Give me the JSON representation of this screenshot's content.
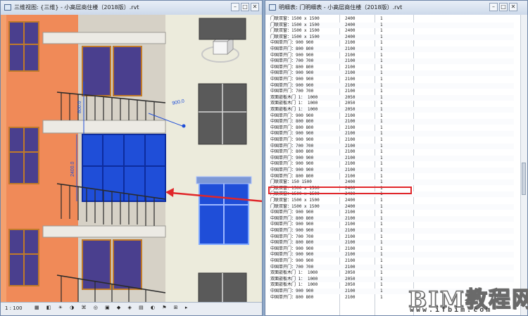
{
  "left_window": {
    "title": "三维视图: {三维} - 小高层商住楼（2018版）.rvt",
    "controls": [
      "–",
      "□",
      "✕"
    ],
    "dimensions": [
      "900.0",
      "2400.0",
      "800.0"
    ],
    "status": {
      "scale": "1 : 100"
    }
  },
  "right_window": {
    "title": "明细表: 门明细表 - 小高层商住楼（2018版）.rvt",
    "controls": [
      "–",
      "□",
      "✕"
    ],
    "rows": [
      [
        "门联双窗：1500 x 1500",
        "2400",
        "1"
      ],
      [
        "门联双窗：1500 x 1500",
        "2400",
        "1"
      ],
      [
        "门联双窗：1500 x 1500",
        "2400",
        "1"
      ],
      [
        "门联双窗：1500 x 1500",
        "2400",
        "1"
      ],
      [
        "中国单开门：900   900",
        "2100",
        "1"
      ],
      [
        "中国单开门：800   800",
        "2100",
        "1"
      ],
      [
        "中国单开门：900   900",
        "2100",
        "1"
      ],
      [
        "中国单开门：700   700",
        "2100",
        "1"
      ],
      [
        "中国单开门：800   800",
        "2100",
        "1"
      ],
      [
        "中国单开门：900   900",
        "2100",
        "1"
      ],
      [
        "中国单开门：900   900",
        "2100",
        "1"
      ],
      [
        "中国单开门：900   900",
        "2100",
        "1"
      ],
      [
        "中国单开门：700   700",
        "2100",
        "1"
      ],
      [
        "双面嵌板木门 1：  1000",
        "2050",
        "1"
      ],
      [
        "双面嵌板木门 1：  1000",
        "2050",
        "1"
      ],
      [
        "双面嵌板木门 1：  1000",
        "2050",
        "1"
      ],
      [
        "中国单开门：900   900",
        "2100",
        "1"
      ],
      [
        "中国单开门：800   800",
        "2100",
        "1"
      ],
      [
        "中国单开门：800   800",
        "2100",
        "1"
      ],
      [
        "中国单开门：900   900",
        "2100",
        "1"
      ],
      [
        "中国单开门：900   900",
        "2100",
        "1"
      ],
      [
        "中国单开门：700   700",
        "2100",
        "1"
      ],
      [
        "中国单开门：800   800",
        "2100",
        "1"
      ],
      [
        "中国单开门：900   900",
        "2100",
        "1"
      ],
      [
        "中国单开门：900   900",
        "2100",
        "1"
      ],
      [
        "中国单开门：900   900",
        "2100",
        "1"
      ],
      [
        "中国单开门：800   800",
        "2100",
        "1"
      ],
      [
        "门联双窗：150     1500",
        "2400",
        "1"
      ],
      [
        "门联双窗：1500 x 1500",
        "2400",
        "1"
      ],
      [
        "门联双窗：1500 x 1500",
        "2400",
        "1"
      ],
      [
        "门联双窗：1500 x 1500",
        "2400",
        "1"
      ],
      [
        "门联双窗：1500 x 1500",
        "2400",
        "1"
      ],
      [
        "中国单开门：900   900",
        "2100",
        "1"
      ],
      [
        "中国单开门：800   800",
        "2100",
        "1"
      ],
      [
        "中国单开门：900   900",
        "2100",
        "1"
      ],
      [
        "中国单开门：900   900",
        "2100",
        "1"
      ],
      [
        "中国单开门：700   700",
        "2100",
        "1"
      ],
      [
        "中国单开门：800   800",
        "2100",
        "1"
      ],
      [
        "中国单开门：900   900",
        "2100",
        "1"
      ],
      [
        "中国单开门：900   900",
        "2100",
        "1"
      ],
      [
        "中国单开门：900   900",
        "2100",
        "1"
      ],
      [
        "中国单开门：700   700",
        "2100",
        "1"
      ],
      [
        "双面嵌板木门 1：  1000",
        "2050",
        "1"
      ],
      [
        "双面嵌板木门 1：  1000",
        "2050",
        "1"
      ],
      [
        "双面嵌板木门 1：  1000",
        "2050",
        "1"
      ],
      [
        "中国单开门：900   900",
        "2100",
        "1"
      ],
      [
        "中国单开门：800   800",
        "2100",
        "1"
      ]
    ],
    "highlight_row_index": 27
  },
  "watermark": {
    "brand": "BIM教程网",
    "url": "www.ifbim.com"
  },
  "colors": {
    "facade_orange": "#f08a58",
    "window_frame": "#c07a2a",
    "glass_purple": "#4a3f8e",
    "selection_blue": "#1f4ed8",
    "annotation_red": "#e0262a"
  }
}
